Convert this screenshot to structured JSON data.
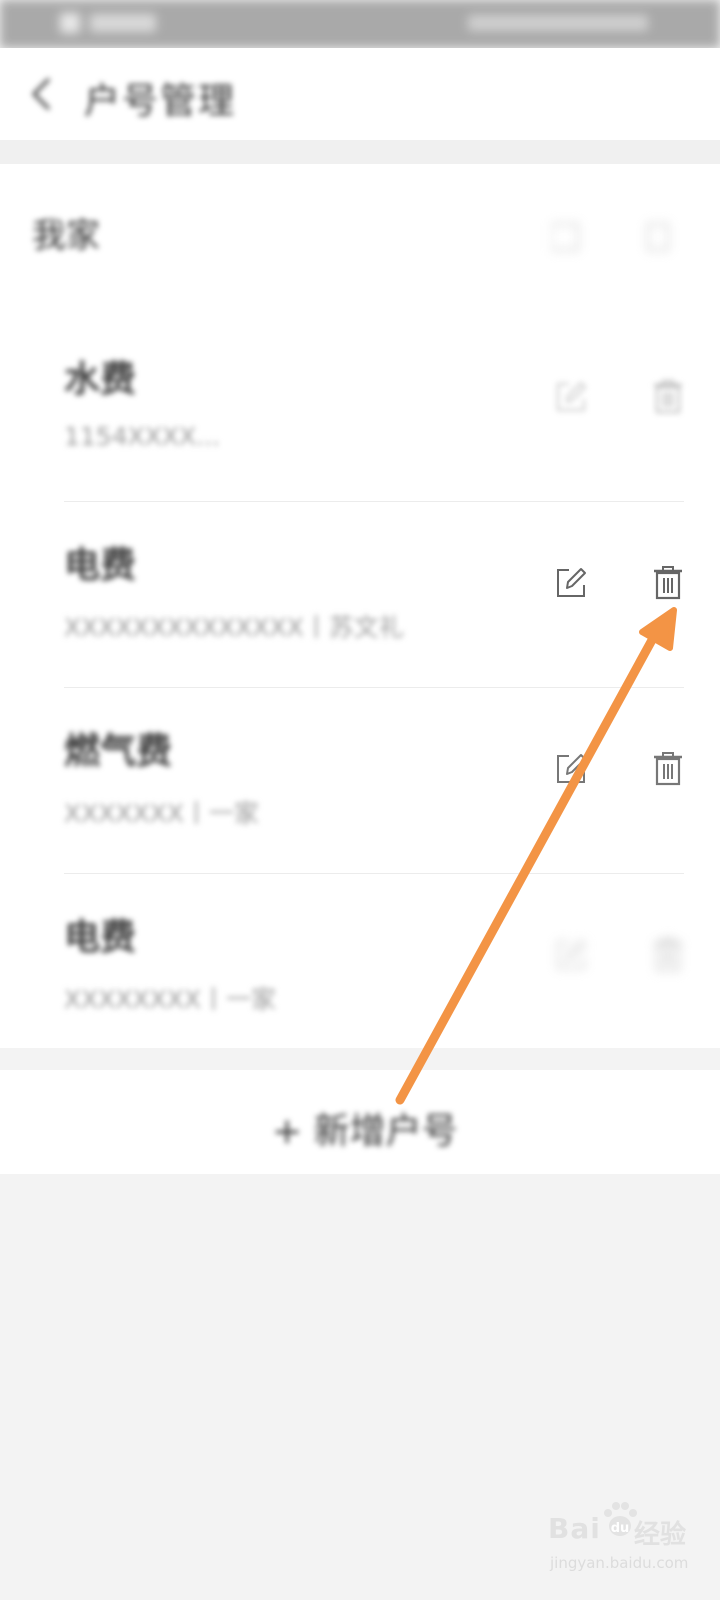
{
  "header": {
    "title": "户号管理"
  },
  "section": {
    "title": "我家"
  },
  "accounts": [
    {
      "name": "水费",
      "detail": "1154XXXX..."
    },
    {
      "name": "电费",
      "detail": "XXXXXXXXXXXXXX丨苏文礼"
    },
    {
      "name": "燃气费",
      "detail": "XXXXXXX丨一家"
    },
    {
      "name": "电费",
      "detail": "XXXXXXXX丨一家"
    }
  ],
  "footer": {
    "add_label": "+ 新增户号"
  },
  "overlay": {
    "arrow_color": "#f39445"
  },
  "watermark": {
    "brand": "Bai",
    "brand2": "经验",
    "url": "jingyan.baidu.com"
  },
  "icons": [
    "back-icon",
    "edit-icon",
    "delete-icon",
    "paw-icon"
  ]
}
